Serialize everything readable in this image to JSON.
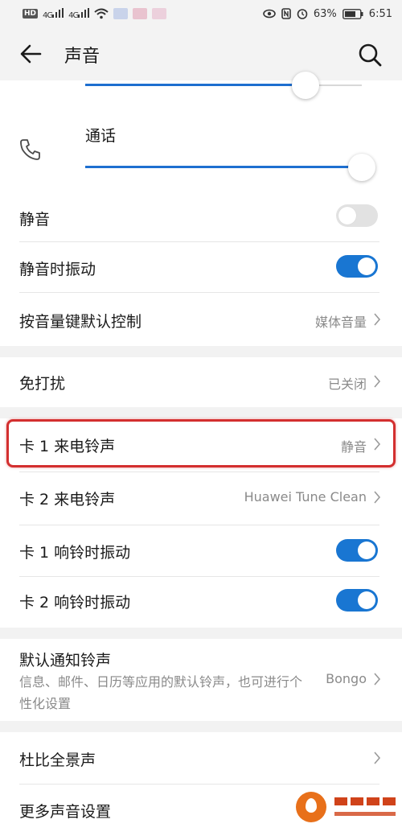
{
  "status_bar": {
    "hd": "HD",
    "sig1": "4G",
    "sig2": "4G",
    "battery_pct": "63%",
    "time": "6:51"
  },
  "appbar": {
    "title": "声音",
    "back_icon": "back-arrow-icon",
    "search_icon": "search-icon"
  },
  "volume": {
    "call_label": "通话",
    "call_icon": "phone-icon",
    "top_slider_level": 0.73,
    "call_slider_level": 1.0
  },
  "settings": {
    "mute": {
      "label": "静音",
      "on": false
    },
    "vibrate_on_mute": {
      "label": "静音时振动",
      "on": true
    },
    "volume_key": {
      "label": "按音量键默认控制",
      "value": "媒体音量"
    },
    "dnd": {
      "label": "免打扰",
      "value": "已关闭"
    },
    "sim1_ringtone": {
      "label": "卡 1 来电铃声",
      "value": "静音"
    },
    "sim2_ringtone": {
      "label": "卡 2 来电铃声",
      "value": "Huawei Tune Clean"
    },
    "sim1_vibrate": {
      "label": "卡 1 响铃时振动",
      "on": true
    },
    "sim2_vibrate": {
      "label": "卡 2 响铃时振动",
      "on": true
    },
    "notification_tone": {
      "label": "默认通知铃声",
      "desc": "信息、邮件、日历等应用的默认铃声，也可进行个性化设置",
      "value": "Bongo"
    },
    "dolby": {
      "label": "杜比全景声"
    },
    "more": {
      "label": "更多声音设置"
    }
  },
  "colors": {
    "accent": "#1976d2",
    "highlight": "#d32f2f",
    "background": "#f2f2f2"
  }
}
